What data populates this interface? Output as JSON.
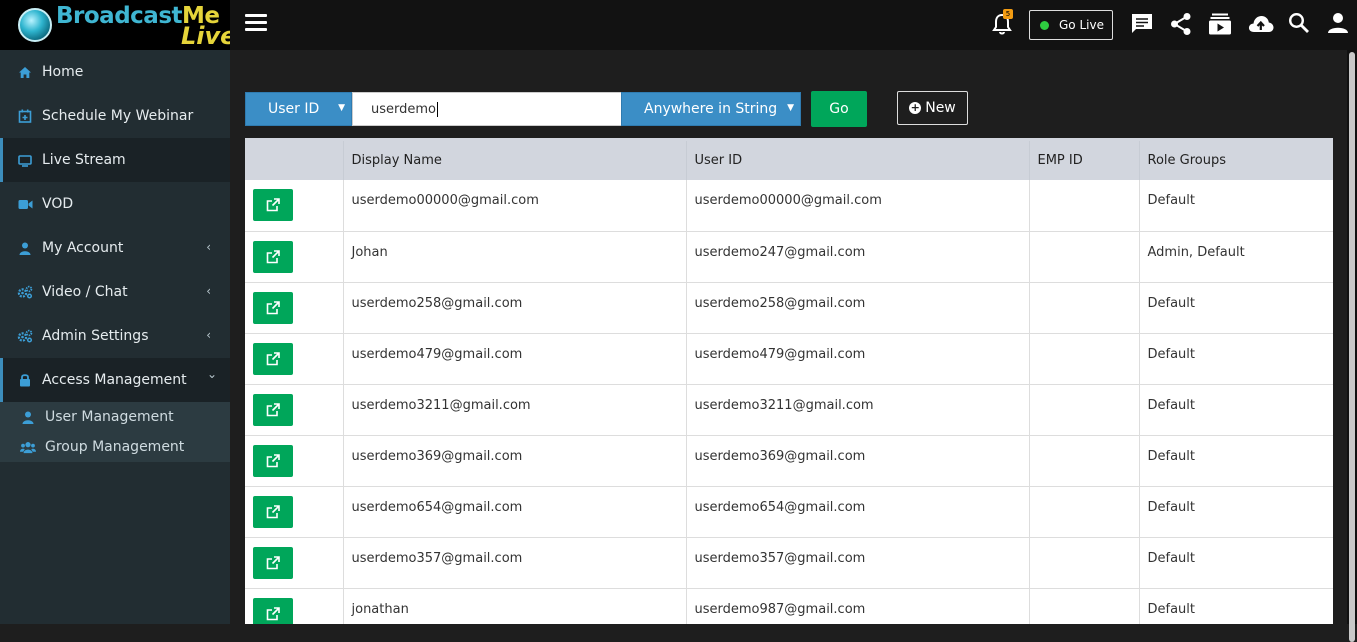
{
  "brand": {
    "line1": "Broadcast",
    "line1_accent": "Me",
    "line2": "Live"
  },
  "sidebar": {
    "items": [
      {
        "label": "Home",
        "icon": "home-icon"
      },
      {
        "label": "Schedule My Webinar",
        "icon": "calendar-plus-icon"
      },
      {
        "label": "Live Stream",
        "icon": "tv-icon"
      },
      {
        "label": "VOD",
        "icon": "video-camera-icon"
      },
      {
        "label": "My Account",
        "icon": "user-icon"
      },
      {
        "label": "Video / Chat",
        "icon": "gears-icon"
      },
      {
        "label": "Admin Settings",
        "icon": "gears-icon"
      },
      {
        "label": "Access Management",
        "icon": "lock-icon"
      }
    ],
    "subitems": [
      {
        "label": "User Management",
        "icon": "user-icon"
      },
      {
        "label": "Group Management",
        "icon": "users-icon"
      }
    ]
  },
  "topbar": {
    "notification_count": "5",
    "go_live_label": "Go Live"
  },
  "filter": {
    "field_value": "User ID",
    "search_value": "userdemo",
    "match_value": "Anywhere in String",
    "go_label": "Go",
    "new_label": "New"
  },
  "table": {
    "columns": [
      "",
      "Display Name",
      "User ID",
      "EMP ID",
      "Role Groups"
    ],
    "rows": [
      {
        "display_name": "userdemo00000@gmail.com",
        "user_id": "userdemo00000@gmail.com",
        "emp_id": "",
        "role_groups": "Default"
      },
      {
        "display_name": "Johan",
        "user_id": "userdemo247@gmail.com",
        "emp_id": "",
        "role_groups": "Admin, Default"
      },
      {
        "display_name": "userdemo258@gmail.com",
        "user_id": "userdemo258@gmail.com",
        "emp_id": "",
        "role_groups": "Default"
      },
      {
        "display_name": "userdemo479@gmail.com",
        "user_id": "userdemo479@gmail.com",
        "emp_id": "",
        "role_groups": "Default"
      },
      {
        "display_name": "userdemo3211@gmail.com",
        "user_id": "userdemo3211@gmail.com",
        "emp_id": "",
        "role_groups": "Default"
      },
      {
        "display_name": "userdemo369@gmail.com",
        "user_id": "userdemo369@gmail.com",
        "emp_id": "",
        "role_groups": "Default"
      },
      {
        "display_name": "userdemo654@gmail.com",
        "user_id": "userdemo654@gmail.com",
        "emp_id": "",
        "role_groups": "Default"
      },
      {
        "display_name": "userdemo357@gmail.com",
        "user_id": "userdemo357@gmail.com",
        "emp_id": "",
        "role_groups": "Default"
      },
      {
        "display_name": "jonathan",
        "user_id": "userdemo987@gmail.com",
        "emp_id": "",
        "role_groups": "Default"
      }
    ]
  },
  "colors": {
    "accent": "#3c8dbc",
    "success": "#00a65a",
    "sidebar_bg": "#222d32",
    "topbar_bg": "#121212"
  }
}
